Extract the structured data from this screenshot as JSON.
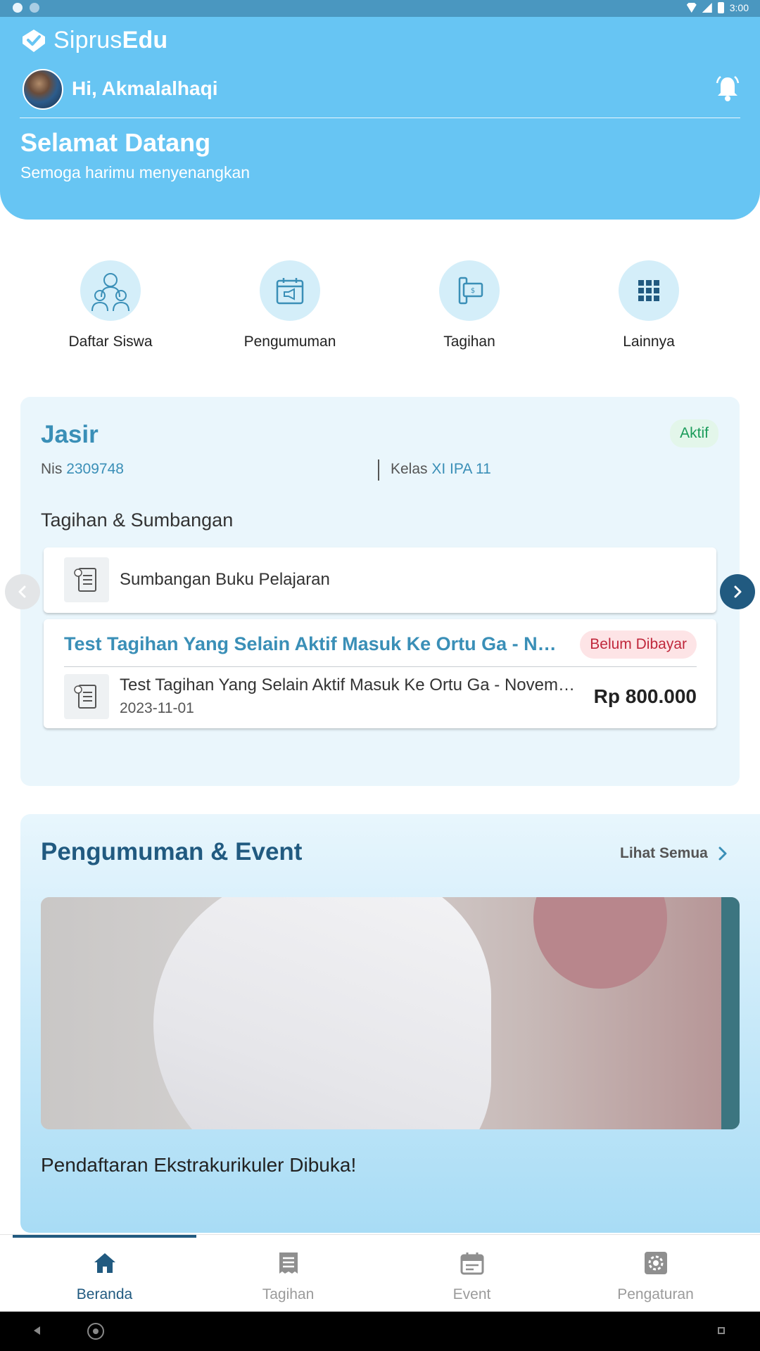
{
  "status_bar": {
    "time": "3:00"
  },
  "header": {
    "brand_light": "Siprus",
    "brand_bold": "Edu",
    "greeting": "Hi, Akmalalhaqi",
    "welcome_title": "Selamat Datang",
    "welcome_subtitle": "Semoga harimu menyenangkan"
  },
  "menu": [
    {
      "label": "Daftar Siswa",
      "icon": "students-icon"
    },
    {
      "label": "Pengumuman",
      "icon": "announcement-icon"
    },
    {
      "label": "Tagihan",
      "icon": "bill-icon"
    },
    {
      "label": "Lainnya",
      "icon": "grid-icon"
    }
  ],
  "student": {
    "name": "Jasir",
    "status": "Aktif",
    "nis_label": "Nis",
    "nis": "2309748",
    "kelas_label": "Kelas",
    "kelas": "XI IPA 11",
    "section_title": "Tagihan & Sumbangan",
    "donation": {
      "label": "Sumbangan Buku Pelajaran"
    },
    "bill": {
      "title": "Test Tagihan Yang Selain Aktif Masuk Ke Ortu Ga - November",
      "status": "Belum Dibayar",
      "item_title": "Test Tagihan Yang Selain Aktif Masuk Ke Ortu Ga - November",
      "date": "2023-11-01",
      "amount": "Rp 800.000"
    }
  },
  "announcements": {
    "title": "Pengumuman & Event",
    "see_all": "Lihat Semua",
    "items": [
      {
        "title": "Pendaftaran Ekstrakurikuler Dibuka!"
      }
    ]
  },
  "bottom_nav": [
    {
      "label": "Beranda",
      "icon": "home-icon",
      "active": true
    },
    {
      "label": "Tagihan",
      "icon": "receipt-icon",
      "active": false
    },
    {
      "label": "Event",
      "icon": "calendar-icon",
      "active": false
    },
    {
      "label": "Pengaturan",
      "icon": "gear-icon",
      "active": false
    }
  ],
  "colors": {
    "header": "#67c5f3",
    "primary": "#215a80",
    "accent_text": "#3a8fb7",
    "active_green": "#1a9b5a",
    "unpaid_red": "#c0283c"
  }
}
